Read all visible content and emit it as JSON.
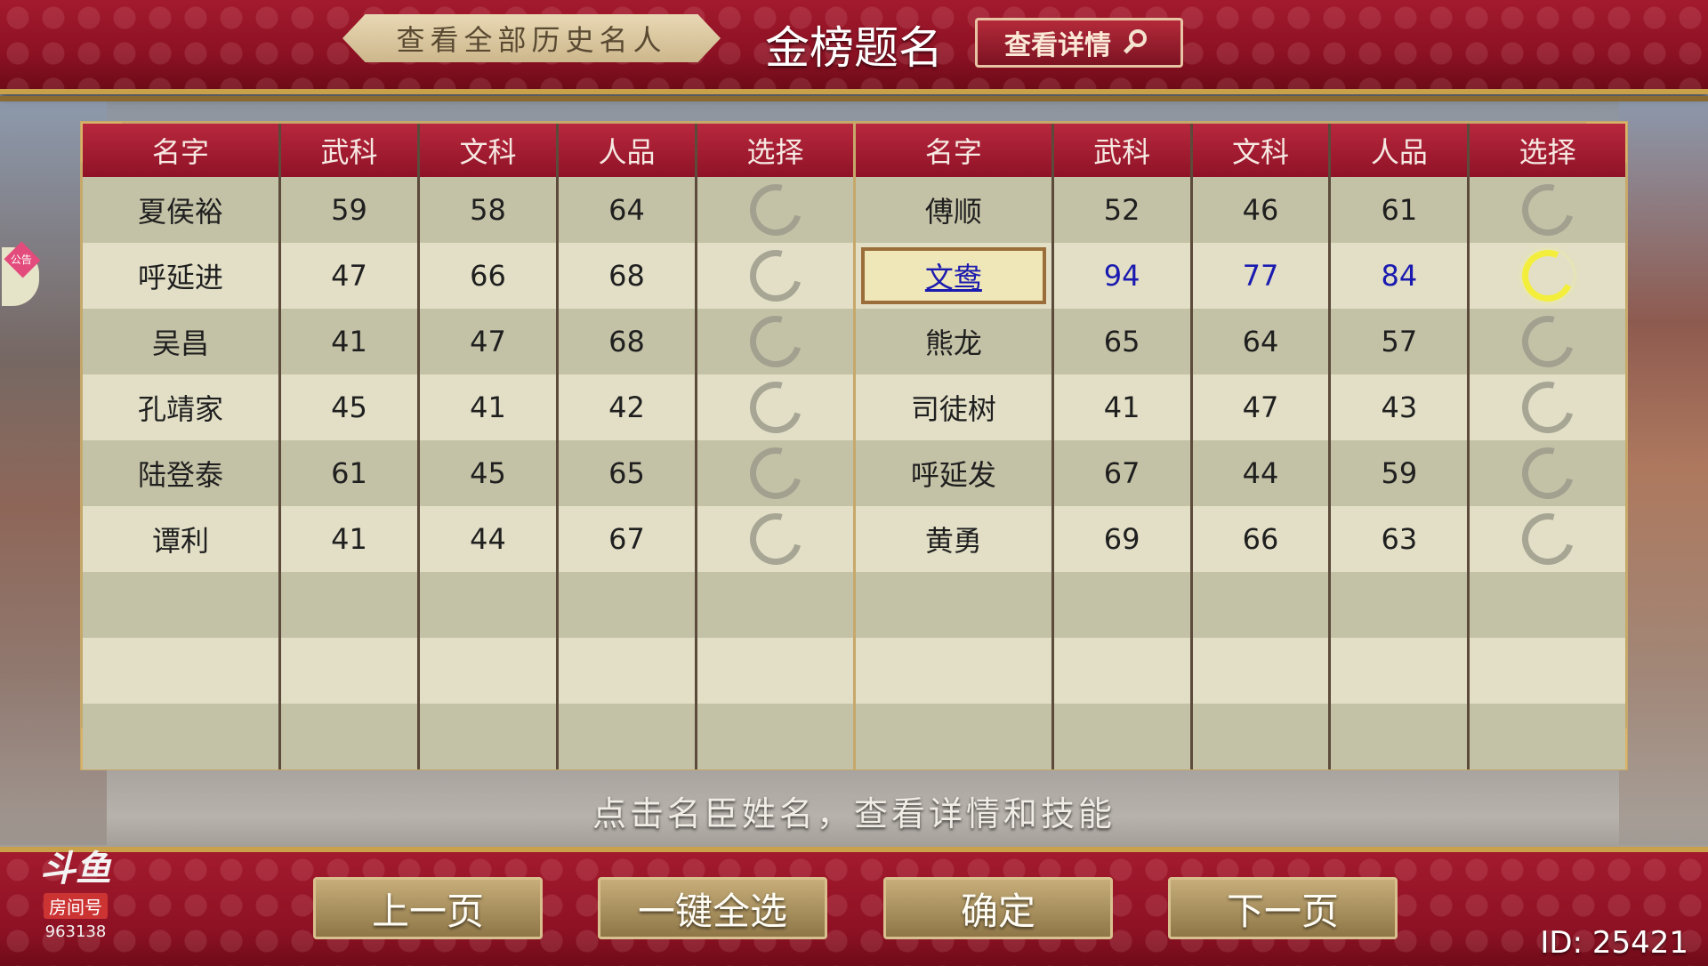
{
  "header": {
    "history_button": "查看全部历史名人",
    "title": "金榜题名",
    "detail_button": "查看详情"
  },
  "columns": [
    "名字",
    "武科",
    "文科",
    "人品",
    "选择"
  ],
  "left_table": [
    {
      "name": "夏侯裕",
      "wu": "59",
      "wen": "58",
      "renpin": "64",
      "selected": false
    },
    {
      "name": "呼延进",
      "wu": "47",
      "wen": "66",
      "renpin": "68",
      "selected": false
    },
    {
      "name": "吴昌",
      "wu": "41",
      "wen": "47",
      "renpin": "68",
      "selected": false
    },
    {
      "name": "孔靖家",
      "wu": "45",
      "wen": "41",
      "renpin": "42",
      "selected": false
    },
    {
      "name": "陆登泰",
      "wu": "61",
      "wen": "45",
      "renpin": "65",
      "selected": false
    },
    {
      "name": "谭利",
      "wu": "41",
      "wen": "44",
      "renpin": "67",
      "selected": false
    }
  ],
  "right_table": [
    {
      "name": "傅顺",
      "wu": "52",
      "wen": "46",
      "renpin": "61",
      "selected": false
    },
    {
      "name": "文鸯",
      "wu": "94",
      "wen": "77",
      "renpin": "84",
      "selected": true
    },
    {
      "name": "熊龙",
      "wu": "65",
      "wen": "64",
      "renpin": "57",
      "selected": false
    },
    {
      "name": "司徒树",
      "wu": "41",
      "wen": "47",
      "renpin": "43",
      "selected": false
    },
    {
      "name": "呼延发",
      "wu": "67",
      "wen": "44",
      "renpin": "59",
      "selected": false
    },
    {
      "name": "黄勇",
      "wu": "69",
      "wen": "66",
      "renpin": "63",
      "selected": false
    }
  ],
  "hint": "点击名臣姓名，查看详情和技能",
  "bottom_buttons": {
    "prev": "上一页",
    "select_all": "一键全选",
    "confirm": "确定",
    "next": "下一页"
  },
  "logo": {
    "mark": "斗鱼",
    "room_label": "房间号",
    "room_number": "963138"
  },
  "id_text": "ID: 25421",
  "side_tag": "公告"
}
